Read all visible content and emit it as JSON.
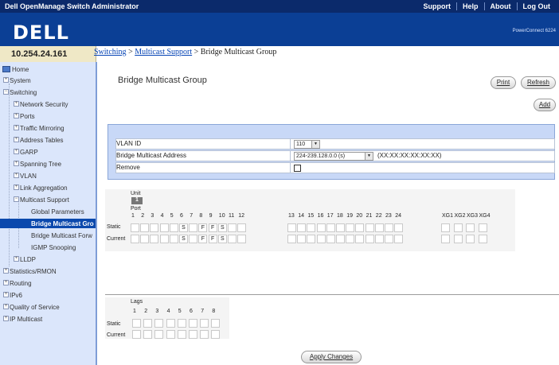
{
  "header": {
    "title": "Dell OpenManage Switch Administrator",
    "links": [
      "Support",
      "Help",
      "About",
      "Log Out"
    ],
    "logo": "DELL",
    "product": "PowerConnect 6224"
  },
  "device": {
    "ip": "10.254.24.161"
  },
  "breadcrumb": {
    "switching": "Switching",
    "multicast": "Multicast Support",
    "current": "Bridge Multicast Group"
  },
  "sidebar": {
    "items": [
      "Home",
      "System",
      "Switching",
      "Network Security",
      "Ports",
      "Traffic Mirroring",
      "Address Tables",
      "GARP",
      "Spanning Tree",
      "VLAN",
      "Link Aggregation",
      "Multicast Support",
      "Global Parameters",
      "Bridge Multicast Gro",
      "Bridge Multicast Forw",
      "IGMP Snooping",
      "LLDP",
      "Statistics/RMON",
      "Routing",
      "IPv6",
      "Quality of Service",
      "IP Multicast"
    ]
  },
  "page": {
    "title": "Bridge Multicast Group",
    "print": "Print",
    "refresh": "Refresh",
    "add": "Add"
  },
  "form": {
    "vlan_label": "VLAN ID",
    "vlan_value": "110",
    "address_label": "Bridge Multicast Address",
    "address_value": "224-239.128.0.0 (s)",
    "address_hint": "(XX:XX:XX:XX:XX:XX)",
    "remove_label": "Remove"
  },
  "ports": {
    "unit": "Unit",
    "unit_value": "1",
    "port": "Port",
    "numbers": [
      "1",
      "2",
      "3",
      "4",
      "5",
      "6",
      "7",
      "8",
      "9",
      "10",
      "11",
      "12",
      "13",
      "14",
      "15",
      "16",
      "17",
      "18",
      "19",
      "20",
      "21",
      "22",
      "23",
      "24",
      "XG1",
      "XG2",
      "XG3",
      "XG4"
    ],
    "static": "Static",
    "current": "Current",
    "static_values": [
      "",
      "",
      "",
      "",
      "",
      "S",
      "",
      "F",
      "F",
      "S",
      "",
      "",
      "",
      "",
      "",
      "",
      "",
      "",
      "",
      "",
      "",
      "",
      "",
      "",
      "",
      "",
      "",
      ""
    ],
    "current_values": [
      "",
      "",
      "",
      "",
      "",
      "S",
      "",
      "F",
      "F",
      "S",
      "",
      "",
      "",
      "",
      "",
      "",
      "",
      "",
      "",
      "",
      "",
      "",
      "",
      "",
      "",
      "",
      "",
      ""
    ]
  },
  "lags": {
    "title": "Lags",
    "numbers": [
      "1",
      "2",
      "3",
      "4",
      "5",
      "6",
      "7",
      "8"
    ],
    "static": "Static",
    "current": "Current"
  },
  "apply": "Apply Changes"
}
